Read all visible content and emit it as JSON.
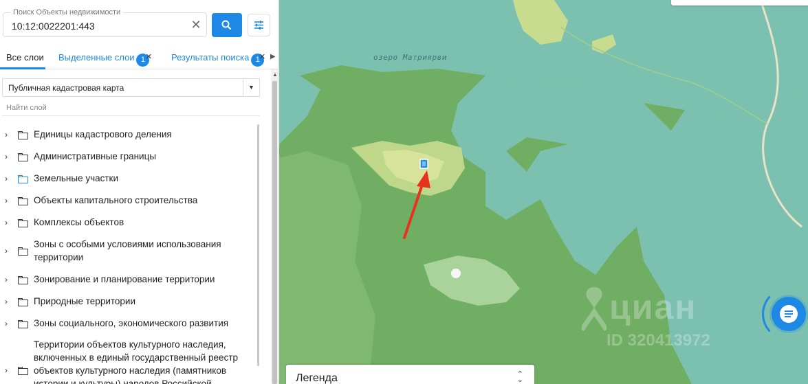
{
  "search": {
    "label": "Поиск Объекты недвижимости",
    "value": "10:12:0022201:443"
  },
  "tabs": {
    "all": "Все слои",
    "selected": "Выделенные слои",
    "selected_count": "1",
    "results": "Результаты поиска",
    "results_count": "1"
  },
  "map_select": "Публичная кадастровая карта",
  "layer_search_placeholder": "Найти слой",
  "layers": [
    "Единицы кадастрового деления",
    "Административные границы",
    "Земельные участки",
    "Объекты капитального строительства",
    "Комплексы объектов",
    "Зоны с особыми условиями использования территории",
    "Зонирование и планирование территории",
    "Природные территории",
    "Зоны социального, экономического развития",
    "Территории объектов культурного наследия, включенных в единый государственный реестр объектов культурного наследия (памятников истории и культуры) народов Российской"
  ],
  "map": {
    "lake_label": "озеро Матриярви",
    "watermark_brand": "циан",
    "watermark_id": "ID 320413972",
    "legend": "Легенда",
    "colors": {
      "water": "#7cc0b0",
      "forest": "#6fae63",
      "marker": "#1e88e5",
      "arrow": "#e8331c"
    }
  }
}
